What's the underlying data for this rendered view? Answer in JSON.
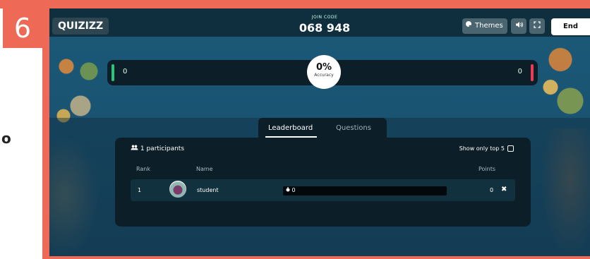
{
  "tutorial": {
    "step_number": "6",
    "side_letter": "o"
  },
  "topbar": {
    "logo": "QUIZIZZ",
    "join_label": "JOIN CODE",
    "join_code": "068 948",
    "themes_label": "Themes",
    "icons": [
      "palette-icon",
      "volume-icon",
      "fullscreen-icon"
    ],
    "end_label": "End"
  },
  "accuracy": {
    "correct_count": "0",
    "incorrect_count": "0",
    "percent": "0%",
    "label": "Accuracy",
    "colors": {
      "correct": "#2fc27b",
      "incorrect": "#ef3b55"
    }
  },
  "tabs": [
    {
      "label": "Leaderboard",
      "active": true
    },
    {
      "label": "Questions",
      "active": false
    }
  ],
  "leaderboard": {
    "participants": "1 participants",
    "show_top_label": "Show only top 5",
    "show_top_checked": false,
    "columns": {
      "rank": "Rank",
      "name": "Name",
      "points": "Points"
    },
    "rows": [
      {
        "rank": "1",
        "name": "student",
        "progress_label": "0",
        "progress_fraction": 0,
        "points": "0"
      }
    ]
  }
}
